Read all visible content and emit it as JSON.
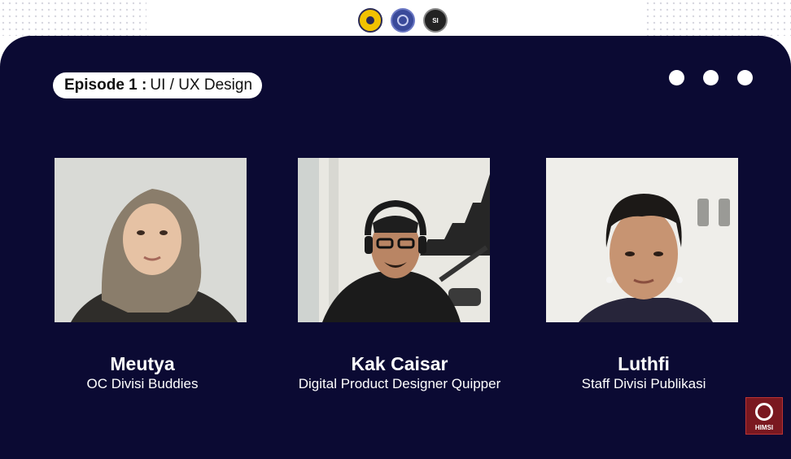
{
  "header": {
    "logos": [
      {
        "icon": "university-emblem-icon"
      },
      {
        "icon": "faculty-emblem-icon"
      },
      {
        "icon": "himsi-logo-icon",
        "text": "SI"
      }
    ]
  },
  "episode": {
    "label": "Episode 1 :",
    "topic": "UI / UX Design"
  },
  "participants": [
    {
      "name": "Meutya",
      "role": "OC Divisi  Buddies"
    },
    {
      "name": "Kak Caisar",
      "role": "Digital Product Designer Quipper"
    },
    {
      "name": "Luthfi",
      "role": "Staff Divisi Publikasi"
    }
  ],
  "watermark": {
    "text": "HIMSI",
    "icon": "himsi-corner-logo-icon"
  },
  "colors": {
    "panel_background": "#0b0a33",
    "accent_white": "#ffffff"
  }
}
